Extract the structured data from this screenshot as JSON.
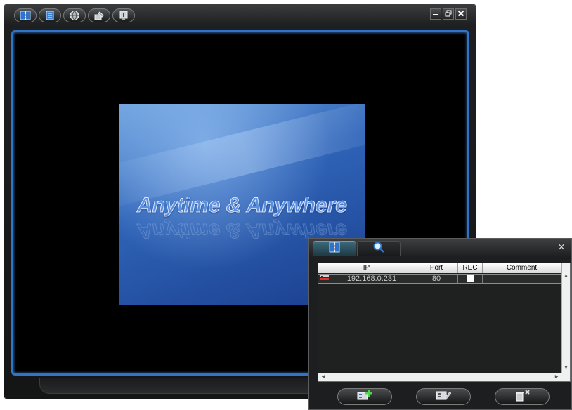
{
  "viewer": {
    "toolbar": [
      {
        "id": "address-book",
        "icon": "address-book-icon"
      },
      {
        "id": "log",
        "icon": "log-list-icon"
      },
      {
        "id": "network",
        "icon": "globe-icon"
      },
      {
        "id": "tools",
        "icon": "tools-icon"
      },
      {
        "id": "info",
        "icon": "info-icon"
      }
    ],
    "window_controls": [
      "minimize-icon",
      "restore-icon",
      "close-icon"
    ],
    "splash_text": "Anytime & Anywhere"
  },
  "address_panel": {
    "tabs": [
      {
        "id": "address-book",
        "icon": "address-book-icon",
        "active": true
      },
      {
        "id": "search",
        "icon": "magnifier-icon",
        "active": false
      }
    ],
    "close_label": "×",
    "columns": [
      "IP",
      "Port",
      "REC",
      "Comment"
    ],
    "rows": [
      {
        "icon": "dvr-device-icon",
        "ip": "192.168.0.231",
        "port": "80",
        "rec": false,
        "comment": ""
      }
    ],
    "actions": [
      {
        "id": "add",
        "icon": "add-device-icon"
      },
      {
        "id": "edit",
        "icon": "edit-device-icon"
      },
      {
        "id": "delete",
        "icon": "delete-device-icon"
      }
    ]
  },
  "colors": {
    "frame_accent": "#2f74c9",
    "splash_blue": "#2f64b8",
    "add_green": "#4cd64c"
  }
}
